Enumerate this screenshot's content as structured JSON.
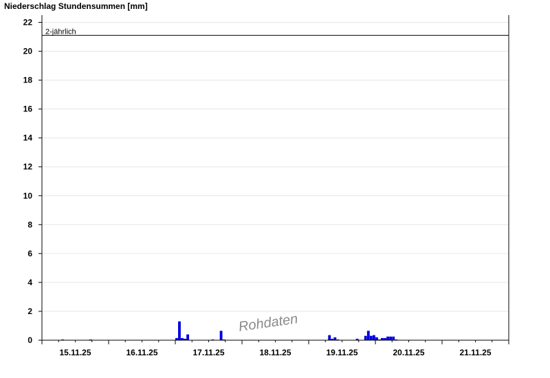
{
  "chart_data": {
    "type": "bar",
    "title": "Niederschlag Stundensummen [mm]",
    "xlabel": "",
    "ylabel": "",
    "ylim": [
      0,
      22.5
    ],
    "yticks": [
      0,
      2,
      4,
      6,
      8,
      10,
      12,
      14,
      16,
      18,
      20,
      22
    ],
    "x_range": [
      0,
      168
    ],
    "x_ticks": [
      {
        "label": "15.11.25",
        "hour": 12
      },
      {
        "label": "16.11.25",
        "hour": 36
      },
      {
        "label": "17.11.25",
        "hour": 60
      },
      {
        "label": "18.11.25",
        "hour": 84
      },
      {
        "label": "19.11.25",
        "hour": 108
      },
      {
        "label": "20.11.25",
        "hour": 132
      },
      {
        "label": "21.11.25",
        "hour": 156
      }
    ],
    "grid": true,
    "bar_color": "#0000dd",
    "threshold": {
      "label": "2-jährlich",
      "value": 21.1
    },
    "watermark": "Rohdaten",
    "series": [
      {
        "hours": [
          7,
          17,
          48,
          49,
          50,
          51,
          52,
          61,
          64,
          65,
          103,
          104,
          105,
          106,
          113,
          116,
          117,
          118,
          119,
          120,
          121,
          122,
          123,
          124,
          125,
          126,
          127
        ],
        "values": [
          0.05,
          0.05,
          0.15,
          1.3,
          0.15,
          0.1,
          0.4,
          0.05,
          0.65,
          0.05,
          0.35,
          0.1,
          0.2,
          0.05,
          0.1,
          0.3,
          0.65,
          0.3,
          0.35,
          0.2,
          0.05,
          0.15,
          0.15,
          0.25,
          0.25,
          0.25,
          0.05
        ]
      }
    ]
  }
}
